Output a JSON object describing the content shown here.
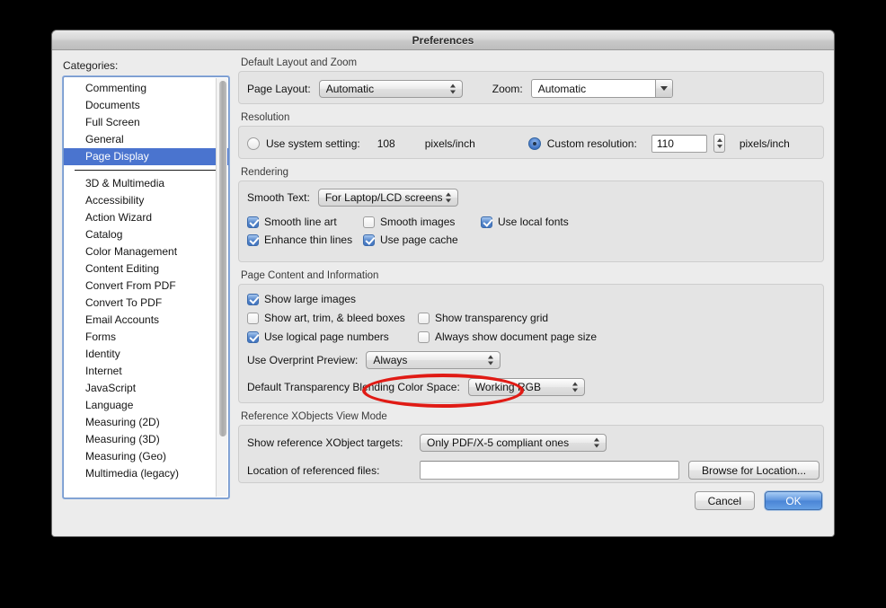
{
  "window": {
    "title": "Preferences"
  },
  "sidebar": {
    "label": "Categories:",
    "top_items": [
      "Commenting",
      "Documents",
      "Full Screen",
      "General",
      "Page Display"
    ],
    "selected": "Page Display",
    "bottom_items": [
      "3D & Multimedia",
      "Accessibility",
      "Action Wizard",
      "Catalog",
      "Color Management",
      "Content Editing",
      "Convert From PDF",
      "Convert To PDF",
      "Email Accounts",
      "Forms",
      "Identity",
      "Internet",
      "JavaScript",
      "Language",
      "Measuring (2D)",
      "Measuring (3D)",
      "Measuring (Geo)",
      "Multimedia (legacy)"
    ]
  },
  "layout_zoom": {
    "group_title": "Default Layout and Zoom",
    "page_layout_label": "Page Layout:",
    "page_layout_value": "Automatic",
    "zoom_label": "Zoom:",
    "zoom_value": "Automatic"
  },
  "resolution": {
    "group_title": "Resolution",
    "system_label": "Use system setting:",
    "system_value": "108",
    "system_units": "pixels/inch",
    "system_selected": false,
    "custom_label": "Custom resolution:",
    "custom_value": "110",
    "custom_units": "pixels/inch",
    "custom_selected": true
  },
  "rendering": {
    "group_title": "Rendering",
    "smooth_text_label": "Smooth Text:",
    "smooth_text_value": "For Laptop/LCD screens",
    "checkboxes": [
      {
        "label": "Smooth line art",
        "checked": true
      },
      {
        "label": "Smooth images",
        "checked": false
      },
      {
        "label": "Use local fonts",
        "checked": true
      },
      {
        "label": "Enhance thin lines",
        "checked": true
      },
      {
        "label": "Use page cache",
        "checked": true
      }
    ]
  },
  "page_content": {
    "group_title": "Page Content and Information",
    "show_large_images": {
      "label": "Show large images",
      "checked": true
    },
    "show_boxes": {
      "label": "Show art, trim, & bleed boxes",
      "checked": false
    },
    "show_transparency": {
      "label": "Show transparency grid",
      "checked": false
    },
    "logical_page_numbers": {
      "label": "Use logical page numbers",
      "checked": true
    },
    "always_show_page_size": {
      "label": "Always show document page size",
      "checked": false
    },
    "overprint_label": "Use Overprint Preview:",
    "overprint_value": "Always",
    "blending_label": "Default Transparency Blending Color Space:",
    "blending_value": "Working RGB"
  },
  "xobjects": {
    "group_title": "Reference XObjects View Mode",
    "targets_label": "Show reference XObject targets:",
    "targets_value": "Only PDF/X-5 compliant ones",
    "location_label": "Location of referenced files:",
    "location_value": "",
    "browse_label": "Browse for Location..."
  },
  "footer": {
    "cancel_label": "Cancel",
    "ok_label": "OK"
  },
  "annotation": {
    "accent_color": "#e01b15",
    "target": "overprint-preview-popup"
  }
}
